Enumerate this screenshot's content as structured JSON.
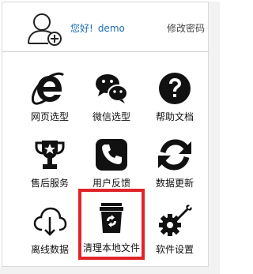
{
  "header": {
    "greeting": "您好!",
    "username": "demo",
    "change_password": "修改密码"
  },
  "tiles": [
    {
      "label": "网页选型",
      "icon": "ie-icon"
    },
    {
      "label": "微信选型",
      "icon": "wechat-icon"
    },
    {
      "label": "帮助文档",
      "icon": "help-icon"
    },
    {
      "label": "售后服务",
      "icon": "trophy-icon"
    },
    {
      "label": "用户反馈",
      "icon": "phone-icon"
    },
    {
      "label": "数据更新",
      "icon": "refresh-icon"
    },
    {
      "label": "离线数据",
      "icon": "cloud-download-icon"
    },
    {
      "label": "清理本地文件",
      "icon": "trash-icon",
      "selected": true
    },
    {
      "label": "软件设置",
      "icon": "settings-icon"
    }
  ],
  "colors": {
    "highlight": "#e0232a",
    "greeting": "#1b6fb5"
  }
}
